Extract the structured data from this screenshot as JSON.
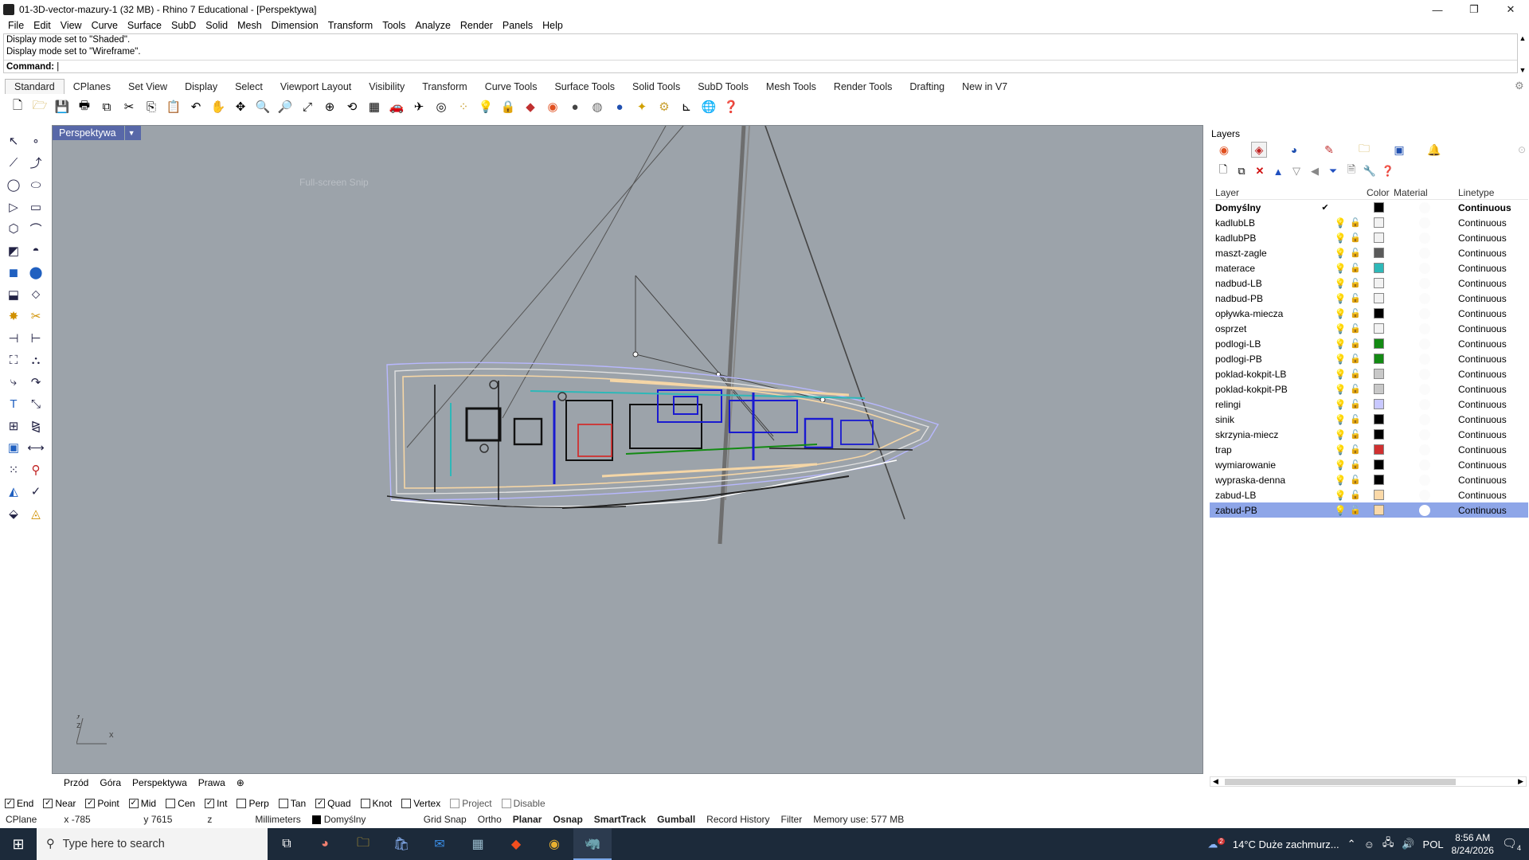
{
  "window": {
    "title": "01-3D-vector-mazury-1 (32 MB) - Rhino 7 Educational - [Perspektywa]",
    "controls": {
      "minimize": "—",
      "restore": "❐",
      "close": "✕"
    }
  },
  "menu": [
    "File",
    "Edit",
    "View",
    "Curve",
    "Surface",
    "SubD",
    "Solid",
    "Mesh",
    "Dimension",
    "Transform",
    "Tools",
    "Analyze",
    "Render",
    "Panels",
    "Help"
  ],
  "command": {
    "history": [
      "Display mode set to \"Shaded\".",
      "Display mode set to \"Wireframe\"."
    ],
    "prompt": "Command:",
    "value": ""
  },
  "toolbar_tabs": [
    "Standard",
    "CPlanes",
    "Set View",
    "Display",
    "Select",
    "Viewport Layout",
    "Visibility",
    "Transform",
    "Curve Tools",
    "Surface Tools",
    "Solid Tools",
    "SubD Tools",
    "Mesh Tools",
    "Render Tools",
    "Drafting",
    "New in V7"
  ],
  "viewport": {
    "name": "Perspektywa",
    "ghost_text": "Full-screen Snip",
    "axis_labels": {
      "y": "y",
      "z": "z",
      "x": "x"
    }
  },
  "view_tabs": [
    "Przód",
    "Góra",
    "Perspektywa",
    "Prawa",
    "⊕"
  ],
  "osnaps": [
    {
      "label": "End",
      "checked": true
    },
    {
      "label": "Near",
      "checked": true
    },
    {
      "label": "Point",
      "checked": true
    },
    {
      "label": "Mid",
      "checked": true
    },
    {
      "label": "Cen",
      "checked": false
    },
    {
      "label": "Int",
      "checked": true
    },
    {
      "label": "Perp",
      "checked": false
    },
    {
      "label": "Tan",
      "checked": false
    },
    {
      "label": "Quad",
      "checked": true
    },
    {
      "label": "Knot",
      "checked": false
    },
    {
      "label": "Vertex",
      "checked": false
    },
    {
      "label": "Project",
      "checked": false,
      "dim": true
    },
    {
      "label": "Disable",
      "checked": false,
      "dim": true
    }
  ],
  "status": {
    "cplane": "CPlane",
    "x": "x -785",
    "y": "y 7615",
    "z": "z",
    "units": "Millimeters",
    "layer": "Domyślny",
    "grid_snap": "Grid Snap",
    "ortho": "Ortho",
    "planar": "Planar",
    "osnap": "Osnap",
    "smarttrack": "SmartTrack",
    "gumball": "Gumball",
    "record_history": "Record History",
    "filter": "Filter",
    "memory": "Memory use: 577 MB"
  },
  "layers_panel": {
    "title": "Layers",
    "columns": {
      "layer": "Layer",
      "color": "Color",
      "material": "Material",
      "linetype": "Linetype"
    },
    "rows": [
      {
        "name": "Domyślny",
        "current": true,
        "color": "#000000",
        "linetype": "Continuous"
      },
      {
        "name": "kadlubLB",
        "color": "#f2f2f2",
        "linetype": "Continuous"
      },
      {
        "name": "kadlubPB",
        "color": "#f2f2f2",
        "linetype": "Continuous"
      },
      {
        "name": "maszt-zagle",
        "color": "#5a5a5a",
        "linetype": "Continuous"
      },
      {
        "name": "materace",
        "color": "#2eb8b8",
        "linetype": "Continuous"
      },
      {
        "name": "nadbud-LB",
        "color": "#f2f2f2",
        "linetype": "Continuous"
      },
      {
        "name": "nadbud-PB",
        "color": "#f2f2f2",
        "linetype": "Continuous"
      },
      {
        "name": "opływka-miecza",
        "color": "#000000",
        "linetype": "Continuous"
      },
      {
        "name": "osprzet",
        "color": "#f2f2f2",
        "linetype": "Continuous"
      },
      {
        "name": "podlogi-LB",
        "color": "#138a13",
        "linetype": "Continuous"
      },
      {
        "name": "podlogi-PB",
        "color": "#138a13",
        "linetype": "Continuous"
      },
      {
        "name": "poklad-kokpit-LB",
        "color": "#c8c8c8",
        "linetype": "Continuous"
      },
      {
        "name": "poklad-kokpit-PB",
        "color": "#c8c8c8",
        "linetype": "Continuous"
      },
      {
        "name": "relingi",
        "color": "#c8c8ff",
        "linetype": "Continuous"
      },
      {
        "name": "sinik",
        "color": "#000000",
        "linetype": "Continuous"
      },
      {
        "name": "skrzynia-miecz",
        "color": "#000000",
        "linetype": "Continuous"
      },
      {
        "name": "trap",
        "color": "#d03030",
        "linetype": "Continuous"
      },
      {
        "name": "wymiarowanie",
        "color": "#000000",
        "linetype": "Continuous"
      },
      {
        "name": "wypraska-denna",
        "color": "#000000",
        "linetype": "Continuous"
      },
      {
        "name": "zabud-LB",
        "color": "#fbd9a8",
        "linetype": "Continuous"
      },
      {
        "name": "zabud-PB",
        "selected": true,
        "color": "#fbd9a8",
        "material": "#ffffff",
        "linetype": "Continuous"
      }
    ]
  },
  "taskbar": {
    "search_placeholder": "Type here to search",
    "weather": "14°C  Duże zachmurz...",
    "lang": "POL",
    "time": "8:56 AM",
    "date": "8/24/2026",
    "notif": "4",
    "weather_badge": "2"
  }
}
